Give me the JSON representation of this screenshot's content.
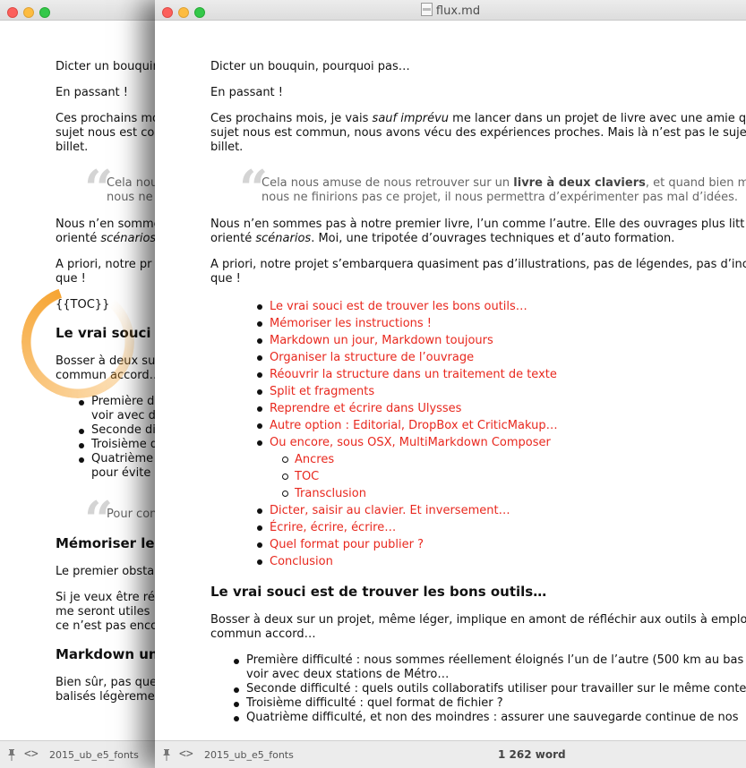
{
  "window": {
    "title": "flux.md",
    "footer_file": "2015_ub_e5_fonts",
    "word_count": "1 262 word"
  },
  "doc": {
    "intro": "Dicter un bouquin, pourquoi pas…",
    "en_passant": "En passant !",
    "para1_a": "Ces prochains mois, je vais ",
    "para1_em": "sauf imprévu",
    "para1_b": " me lancer dans un projet de livre avec une amie q",
    "para1_c": "sujet nous est commun, nous avons vécu des expériences proches. Mais là n’est pas le suje",
    "para1_d": "billet.",
    "quote_a": "Cela nous amuse de nous retrouver sur un ",
    "quote_strong": "livre à deux claviers",
    "quote_b": ", et quand bien m",
    "quote_c": "nous ne finirions pas ce projet, il nous permettra d’expérimenter pas mal d’idées.",
    "para2_a": "Nous n’en sommes pas à notre premier livre, l’un comme l’autre. Elle des ouvrages plus litt",
    "para2_b": "orienté ",
    "para2_em": "scénarios",
    "para2_c": ". Moi, une tripotée d’ouvrages techniques et d’auto formation.",
    "para3_a": "A priori, notre projet s’embarquera quasiment pas d’illustrations, pas de légendes, pas d’inc",
    "para3_b": "que !",
    "toc": [
      "Le vrai souci est de trouver les bons outils…",
      "Mémoriser les instructions !",
      "Markdown un jour, Markdown toujours",
      "Organiser la structure de l’ouvrage",
      "Réouvrir la structure dans un traitement de texte",
      "Split et fragments",
      "Reprendre et écrire dans Ulysses",
      "Autre option : Editorial, DropBox et CriticMakup…",
      "Ou encore, sous OSX, MultiMarkdown Composer"
    ],
    "toc_sub": [
      "Ancres",
      "TOC",
      "Transclusion"
    ],
    "toc_tail": [
      "Dicter, saisir au clavier. Et inversement…",
      "Écrire, écrire, écrire…",
      "Quel format pour publier ?",
      "Conclusion"
    ],
    "heading1": "Le vrai souci est de trouver les bons outils…",
    "para4_a": "Bosser à deux sur un projet, même léger, implique en amont de réfléchir aux outils à emplo",
    "para4_b": "commun accord…",
    "bullets": [
      "Première difficulté : nous sommes réellement éloignés l’un de l’autre (500 km au bas",
      "Seconde difficulté : quels outils collaboratifs utiliser pour travailler sur le même conte",
      "Troisième difficulté : quel format de fichier ?",
      "Quatrième difficulté, et non des moindres : assurer une sauvegarde continue de nos"
    ],
    "bullet1_cont": "voir avec deux stations de Métro…"
  },
  "back": {
    "intro": "Dicter un bouquin",
    "en_passant": "En passant !",
    "para1_a": "Ces prochains mo",
    "para1_b": "sujet nous est co",
    "para1_c": "billet.",
    "quote_a": "Cela nous",
    "quote_b": "nous ne",
    "para2_a": "Nous n’en somme",
    "para2_b": "orienté ",
    "para2_em": "scénarios",
    "para3_a": "A priori, notre pr",
    "para3_b": "que !",
    "toc_tag": "{{TOC}}",
    "heading1": "Le vrai souci",
    "para4_a": "Bosser à deux su",
    "para4_b": "commun accord…",
    "bullets": [
      "Première d",
      "Seconde di",
      "Troisième d",
      "Quatrième"
    ],
    "bullet1_cont": "voir avec d",
    "bullet4_cont": "pour évite",
    "quote2": "Pour con",
    "heading2": "Mémoriser le",
    "para5": "Le premier obsta",
    "para6_a": "Si je veux être ré",
    "para6_b": "me seront utiles",
    "para6_c": "ce n’est pas enco",
    "heading3": "Markdown un",
    "para7_a": "Bien sûr, pas que",
    "para7_b": "balisés légèreme",
    "footer_file": "2015_ub_e5_fonts"
  }
}
